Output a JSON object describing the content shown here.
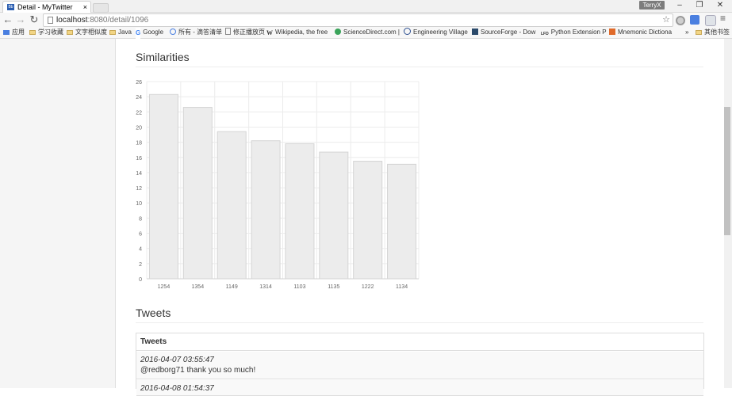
{
  "browser": {
    "tab_title": "Detail - MyTwitter",
    "tab_favicon": "Bb",
    "tab_close": "×",
    "user_badge": "TerryX",
    "url_host": "localhost",
    "url_rest": ":8080/detail/1096",
    "menu_glyph": "≡"
  },
  "bookmarks": {
    "items": [
      {
        "label": "应用",
        "icon": "apps-icon"
      },
      {
        "label": "学习收藏",
        "icon": "folder-icon"
      },
      {
        "label": "文字相似度",
        "icon": "folder-icon"
      },
      {
        "label": "Java",
        "icon": "folder-icon"
      },
      {
        "label": "Google",
        "icon": "google-icon"
      },
      {
        "label": "所有 - 滴答清单",
        "icon": "check-icon"
      },
      {
        "label": "修正播放页",
        "icon": "page-icon"
      },
      {
        "label": "Wikipedia, the free",
        "icon": "wikipedia-icon"
      },
      {
        "label": "ScienceDirect.com |",
        "icon": "sciencedirect-icon"
      },
      {
        "label": "Engineering Village",
        "icon": "ev-icon"
      },
      {
        "label": "SourceForge - Dow",
        "icon": "sourceforge-icon"
      },
      {
        "label": "Python Extension P",
        "icon": "lfd-icon"
      },
      {
        "label": "Mnemonic Dictiona",
        "icon": "md-icon"
      }
    ],
    "overflow": "»",
    "other": "其他书签"
  },
  "similarities": {
    "heading": "Similarities"
  },
  "chart_data": {
    "type": "bar",
    "categories": [
      "1254",
      "1354",
      "1149",
      "1314",
      "1103",
      "1135",
      "1222",
      "1134"
    ],
    "values": [
      24.3,
      22.6,
      19.4,
      18.2,
      17.8,
      16.7,
      15.5,
      15.1
    ],
    "y_ticks": [
      "0",
      "2",
      "4",
      "6",
      "8",
      "10",
      "12",
      "14",
      "16",
      "18",
      "20",
      "22",
      "24",
      "26"
    ],
    "ylim": [
      0,
      26
    ],
    "grid": true,
    "bar_color": "#ececec",
    "bar_border": "#d4d4d4"
  },
  "tweets": {
    "heading": "Tweets",
    "panel_title": "Tweets",
    "rows": [
      {
        "time": "2016-04-07 03:55:47",
        "text": "@redborg71 thank you so much!"
      },
      {
        "time": "2016-04-08 01:54:37",
        "text": ""
      }
    ]
  }
}
